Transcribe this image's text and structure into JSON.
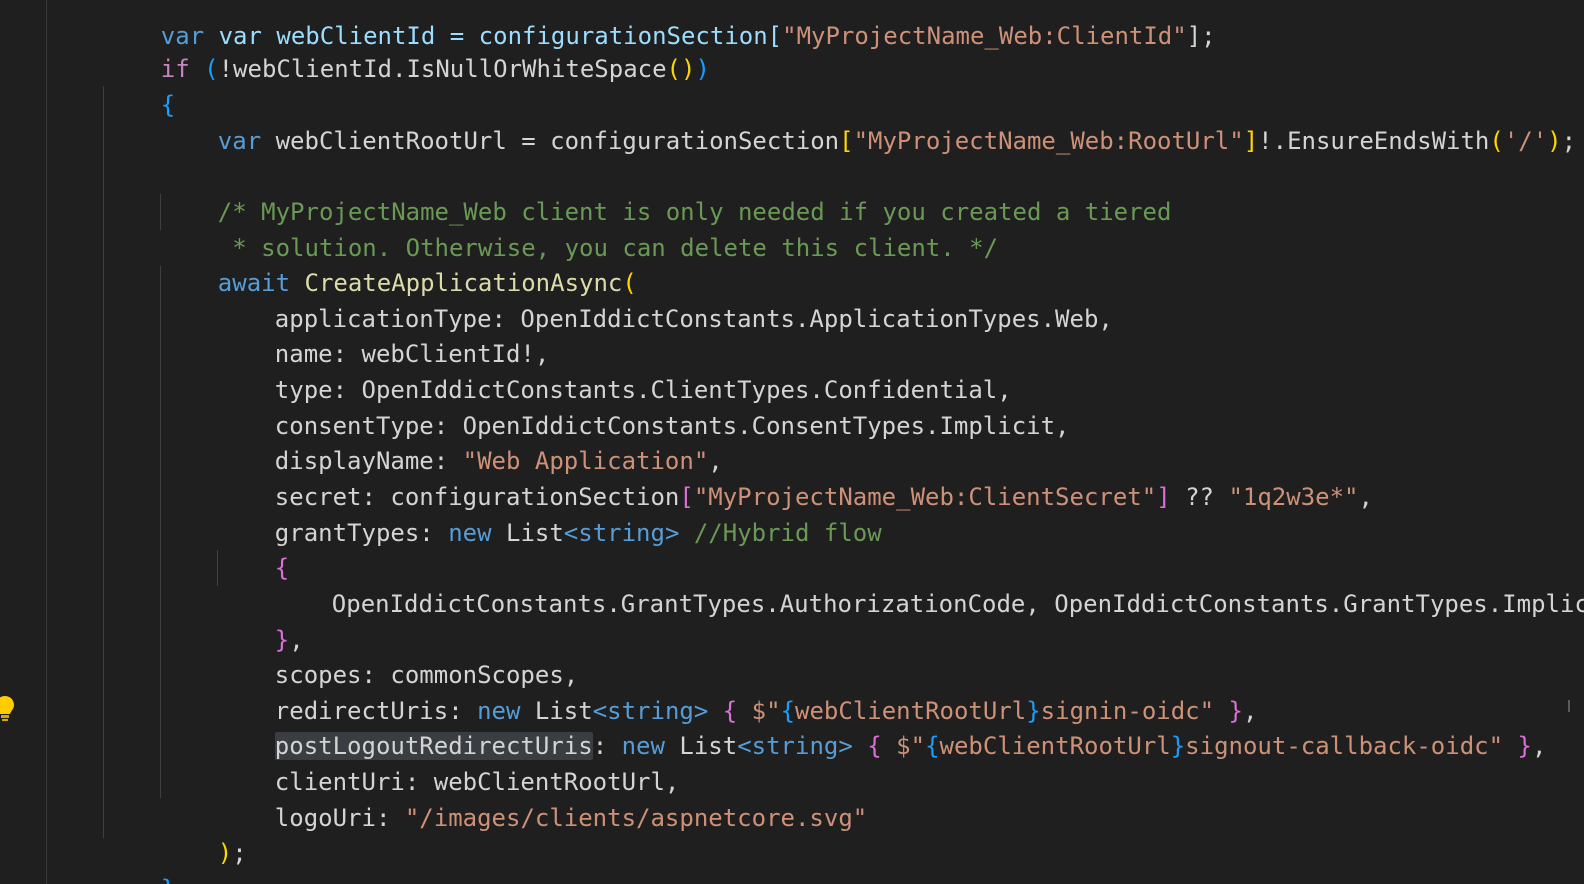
{
  "editor": {
    "lines": {
      "l0": {
        "a": "var webClientId = configurationSection[",
        "b": "\"MyProjectName_Web:ClientId\"",
        "c": "];"
      },
      "l1": {
        "kw": "if",
        "b": " (",
        "c": "!webClientId.IsNullOrWhiteSpace",
        "d": "()",
        "e": ")"
      },
      "l2": {
        "brace": "{"
      },
      "l3": {
        "kw": "var",
        "a": " webClientRootUrl = configurationSection",
        "b": "[",
        "s": "\"MyProjectName_Web:RootUrl\"",
        "c": "]",
        "d": "!.EnsureEndsWith",
        "e": "(",
        "s2": "'/'",
        "f": ")",
        "g": ";"
      },
      "l5": {
        "cmt": "/* MyProjectName_Web client is only needed if you created a tiered"
      },
      "l6": {
        "cmt": " * solution. Otherwise, you can delete this client. */"
      },
      "l7": {
        "kw": "await",
        "a": " CreateApplicationAsync",
        "b": "("
      },
      "l8": {
        "a": "applicationType: OpenIddictConstants.ApplicationTypes.Web,"
      },
      "l9": {
        "a": "name: webClientId!,"
      },
      "l10": {
        "a": "type: OpenIddictConstants.ClientTypes.Confidential,"
      },
      "l11": {
        "a": "consentType: OpenIddictConstants.ConsentTypes.Implicit,"
      },
      "l12": {
        "a": "displayName: ",
        "s": "\"Web Application\"",
        "b": ","
      },
      "l13": {
        "a": "secret: configurationSection",
        "b": "[",
        "s": "\"MyProjectName_Web:ClientSecret\"",
        "c": "]",
        "d": " ?? ",
        "s2": "\"1q2w3e*\"",
        "e": ","
      },
      "l14": {
        "a": "grantTypes: ",
        "kw": "new",
        "b": " List",
        "c": "<",
        "d": "string",
        "e": ">",
        "cmt": " //Hybrid flow"
      },
      "l15": {
        "brace": "{"
      },
      "l16": {
        "a": "OpenIddictConstants.GrantTypes.AuthorizationCode, OpenIddictConstants.GrantTypes.Implicit"
      },
      "l17": {
        "brace": "}",
        "a": ","
      },
      "l18": {
        "a": "scopes: commonScopes,"
      },
      "l19": {
        "a": "redirectUris: ",
        "kw": "new",
        "b": " List",
        "c": "<",
        "d": "string",
        "e": ">",
        "f": " { ",
        "g": "$\"",
        "h": "{",
        "i": "webClientRootUrl",
        "j": "}",
        "k": "signin-oidc\"",
        "l": " }",
        "m": ","
      },
      "l20": {
        "hl": "postLogoutRedirectUris",
        "a": ": ",
        "kw": "new",
        "b": " List",
        "c": "<",
        "d": "string",
        "e": ">",
        "f": " { ",
        "g": "$\"",
        "h": "{",
        "i": "webClientRootUrl",
        "j": "}",
        "k": "signout-callback-oidc\"",
        "l": " }",
        "m": ","
      },
      "l21": {
        "a": "clientUri: webClientRootUrl,"
      },
      "l22": {
        "a": "logoUri: ",
        "s": "\"/images/clients/aspnetcore.svg\""
      },
      "l23": {
        "a": ")",
        "b": ";"
      },
      "l24": {
        "brace": "}"
      }
    }
  }
}
